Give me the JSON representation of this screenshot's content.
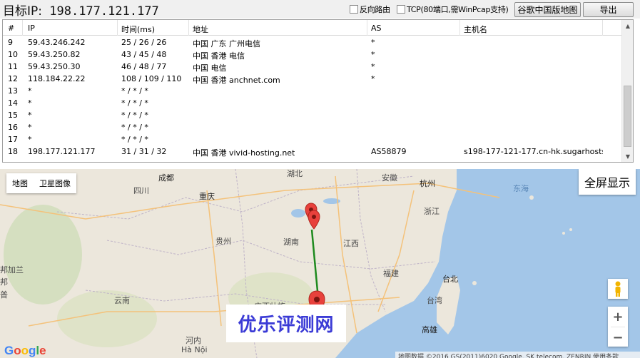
{
  "toolbar": {
    "target_label": "目标IP:",
    "target_ip": "198.177.121.177",
    "reverse_route_label": "反向路由",
    "tcp_label": "TCP(80端口,需WinPcap支持)",
    "google_map_button": "谷歌中国版地图",
    "export_button": "导出"
  },
  "table": {
    "columns": [
      "#",
      "IP",
      "时间(ms)",
      "地址",
      "AS",
      "主机名"
    ],
    "rows": [
      [
        "9",
        "59.43.246.242",
        "25 / 26 / 26",
        "中国 广东 广州电信",
        "*",
        ""
      ],
      [
        "10",
        "59.43.250.82",
        "43 / 45 / 48",
        "中国 香港 电信",
        "*",
        ""
      ],
      [
        "11",
        "59.43.250.30",
        "46 / 48 / 77",
        "中国 电信",
        "*",
        ""
      ],
      [
        "12",
        "118.184.22.22",
        "108 / 109 / 110",
        "中国 香港 anchnet.com",
        "*",
        ""
      ],
      [
        "13",
        "*",
        "* / * / *",
        "",
        "",
        ""
      ],
      [
        "14",
        "*",
        "* / * / *",
        "",
        "",
        ""
      ],
      [
        "15",
        "*",
        "* / * / *",
        "",
        "",
        ""
      ],
      [
        "16",
        "*",
        "* / * / *",
        "",
        "",
        ""
      ],
      [
        "17",
        "*",
        "* / * / *",
        "",
        "",
        ""
      ],
      [
        "18",
        "198.177.121.177",
        "31 / 31 / 32",
        "中国 香港 vivid-hosting.net",
        "AS58879",
        "s198-177-121-177.cn-hk.sugarhosts..."
      ]
    ]
  },
  "map": {
    "map_type_buttons": [
      "地图",
      "卫星图像"
    ],
    "fullscreen_label": "全屏显示",
    "zoom_in": "+",
    "zoom_out": "−",
    "watermark": "优乐评测网",
    "google_logo": "Google",
    "attribution": "地图数据 ©2016 GS(2011)6020 Google, SK telecom, ZENRIN   使用条款",
    "labels": [
      "成都",
      "湖北",
      "安徽",
      "杭州",
      "东海",
      "四川",
      "重庆",
      "浙江",
      "贵州",
      "湖南",
      "江西",
      "邦加兰",
      "福建",
      "台北",
      "云南",
      "广西壮族",
      "台湾",
      "高雄",
      "河内",
      "Hà Nội",
      "邦",
      "普"
    ],
    "route_color": "#1e8a1e",
    "marker_color": "#e8413c"
  }
}
